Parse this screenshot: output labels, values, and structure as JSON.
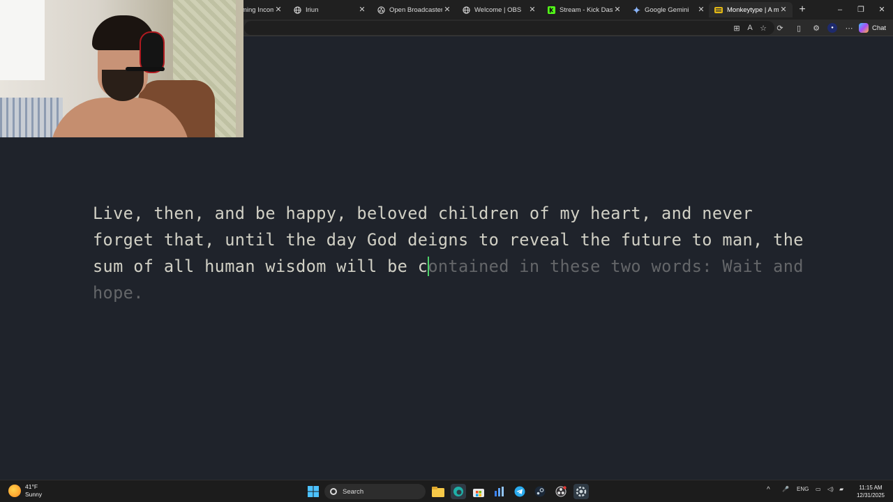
{
  "browser": {
    "tabs": [
      {
        "label": "ming Income",
        "icon": "partial-tab-icon",
        "active": false
      },
      {
        "label": "Iriun",
        "icon": "globe-icon",
        "active": false
      },
      {
        "label": "Open Broadcaster Softw",
        "icon": "obs-icon",
        "active": false
      },
      {
        "label": "Welcome | OBS",
        "icon": "globe-icon",
        "active": false
      },
      {
        "label": "Stream - Kick Dashboar",
        "icon": "kick-icon",
        "active": false
      },
      {
        "label": "Google Gemini",
        "icon": "gemini-icon",
        "active": false
      },
      {
        "label": "Monkeytype | A minima",
        "icon": "monkeytype-icon",
        "active": true
      }
    ],
    "chat_label": "Chat",
    "accent_green": "#53fc18"
  },
  "monkeytype": {
    "typed_text": "Live, then, and be happy, beloved children of my heart, and never forget that, until the day God deigns to reveal the future to man, the sum of all human wisdom will be c",
    "untyped_text": "ontained in these two words: Wait and hope.",
    "colors": {
      "background": "#1f232b",
      "typed": "#d1d0c5",
      "untyped": "#646669",
      "caret": "#4ed36a"
    }
  },
  "taskbar": {
    "weather_temp": "41°F",
    "weather_condition": "Sunny",
    "search_label": "Search",
    "language": "ENG",
    "time": "11:15 AM",
    "date": "12/31/2025"
  }
}
